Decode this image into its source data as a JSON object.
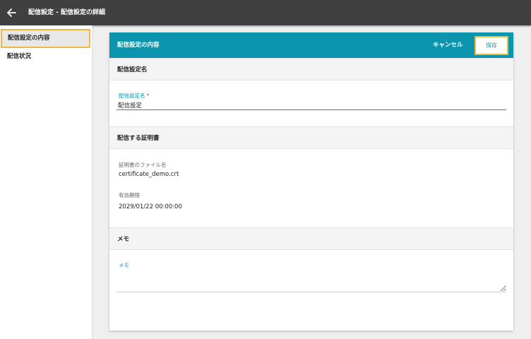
{
  "header": {
    "title": "配信設定 - 配信設定の詳細"
  },
  "sidebar": {
    "items": [
      {
        "label": "配信設定の内容"
      },
      {
        "label": "配信状況"
      }
    ]
  },
  "card": {
    "title": "配信設定の内容",
    "cancel_label": "キャンセル",
    "save_label": "保存"
  },
  "sections": {
    "name": {
      "heading": "配信設定名",
      "field_label": "配信設定名",
      "required_mark": "*",
      "value": "配信設定"
    },
    "certificate": {
      "heading": "配信する証明書",
      "file_label": "証明書のファイル名",
      "file_value": "certificate_demo.crt",
      "expiry_label": "有効期限",
      "expiry_value": "2029/01/22 00:00:00"
    },
    "memo": {
      "heading": "メモ",
      "field_label": "メモ",
      "value": ""
    }
  },
  "colors": {
    "accent": "#0a94ad",
    "highlight": "#f0b840",
    "topbar": "#404040"
  }
}
